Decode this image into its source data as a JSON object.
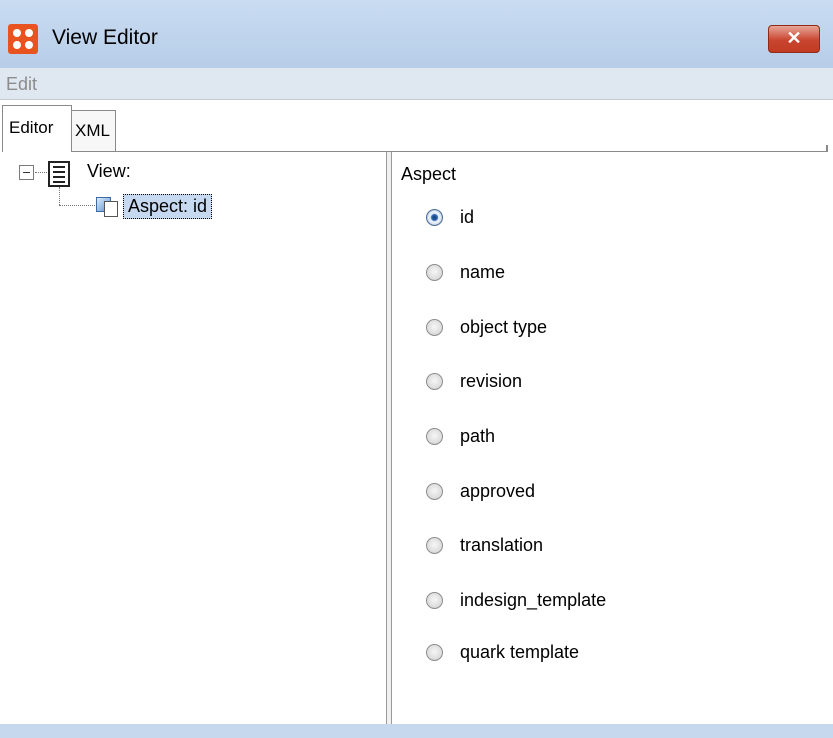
{
  "window": {
    "title": "View Editor",
    "close_label": "✕"
  },
  "menu": {
    "edit_label": "Edit"
  },
  "tabs": [
    {
      "label": "Editor",
      "selected": true
    },
    {
      "label": "XML",
      "selected": false
    }
  ],
  "tree": {
    "root_label": "View:",
    "child_label": "Aspect: id"
  },
  "aspect_panel": {
    "title": "Aspect",
    "selected": "id",
    "options": [
      "id",
      "name",
      "object type",
      "revision",
      "path",
      "approved",
      "translation",
      "indesign_template",
      "quark template"
    ]
  }
}
